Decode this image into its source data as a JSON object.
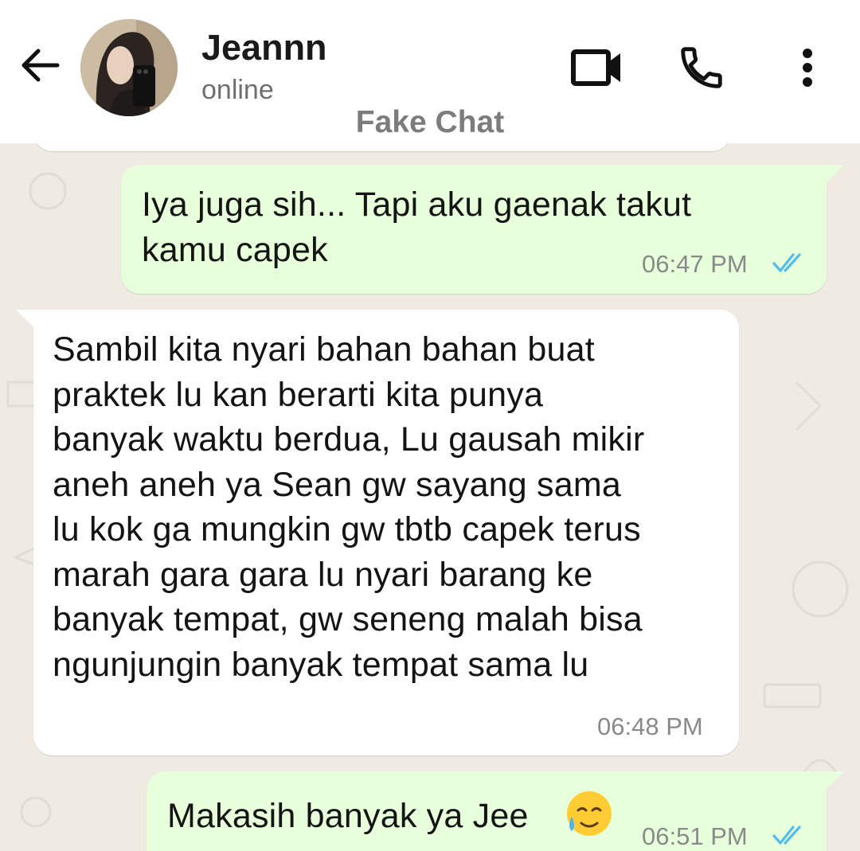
{
  "header": {
    "contact_name": "Jeannn",
    "status": "online",
    "watermark": "Fake Chat",
    "icons": [
      "back-arrow-icon",
      "avatar",
      "video-camera-icon",
      "phone-icon",
      "more-vertical-icon"
    ]
  },
  "messages": [
    {
      "direction": "outgoing",
      "text": "Iya juga sih... Tapi aku gaenak takut\nkamu capek",
      "time": "06:47 PM",
      "status": "read"
    },
    {
      "direction": "incoming",
      "text": "Sambil kita nyari bahan bahan buat\npraktek lu kan berarti kita punya\nbanyak waktu berdua, Lu gausah mikir\naneh aneh ya Sean gw sayang sama\nlu kok ga mungkin gw tbtb capek terus\nmarah gara gara lu nyari barang ke\nbanyak tempat, gw seneng malah bisa\nngunjungin banyak tempat sama lu",
      "time": "06:48 PM"
    },
    {
      "direction": "outgoing",
      "text": "Makasih banyak ya Jee",
      "emoji_icon": "smiling-face-with-tear-emoji",
      "time": "06:51 PM",
      "status": "read"
    }
  ],
  "colors": {
    "outgoing_bubble": "#e7ffdb",
    "incoming_bubble": "#ffffff",
    "chat_background": "#efeae2",
    "read_ticks": "#53bdeb",
    "timestamp": "#8a8a8a"
  }
}
